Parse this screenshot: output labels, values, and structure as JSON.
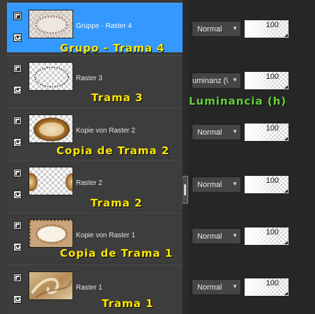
{
  "layers": [
    {
      "name": "Gruppe - Raster 4",
      "caption": "Grupo - Trama 4",
      "blend_mode": "Normal",
      "opacity": "100",
      "selected": true,
      "thumbnail_icon": "lace-frame-thumbnail"
    },
    {
      "name": "Raster 3",
      "caption": "Trama 3",
      "blend_mode": "uminanz (\\",
      "opacity": "100",
      "selected": false,
      "thumbnail_icon": "dotted-oval-thumbnail"
    },
    {
      "name": "Kopie von Raster 2",
      "caption": "Copia de Trama 2",
      "blend_mode": "Normal",
      "opacity": "100",
      "selected": false,
      "thumbnail_icon": "golden-oval-thumbnail"
    },
    {
      "name": "Raster 2",
      "caption": "Trama 2",
      "blend_mode": "Normal",
      "opacity": "100",
      "selected": false,
      "thumbnail_icon": "split-oval-thumbnail"
    },
    {
      "name": "Kopie von Raster 1",
      "caption": "Copia de Trama 1",
      "blend_mode": "Normal",
      "opacity": "100",
      "selected": false,
      "thumbnail_icon": "ornate-frame-thumbnail"
    },
    {
      "name": "Raster 1",
      "caption": "Trama 1",
      "blend_mode": "Normal",
      "opacity": "100",
      "selected": false,
      "thumbnail_icon": "swirl-gold-thumbnail"
    }
  ],
  "annotations": {
    "blend_note": "Luminancia (h)"
  },
  "colors": {
    "selected_row": "#3399ff",
    "caption_yellow": "#ffe800",
    "caption_green": "#66d13c",
    "panel_bg": "#3b3b3b"
  }
}
